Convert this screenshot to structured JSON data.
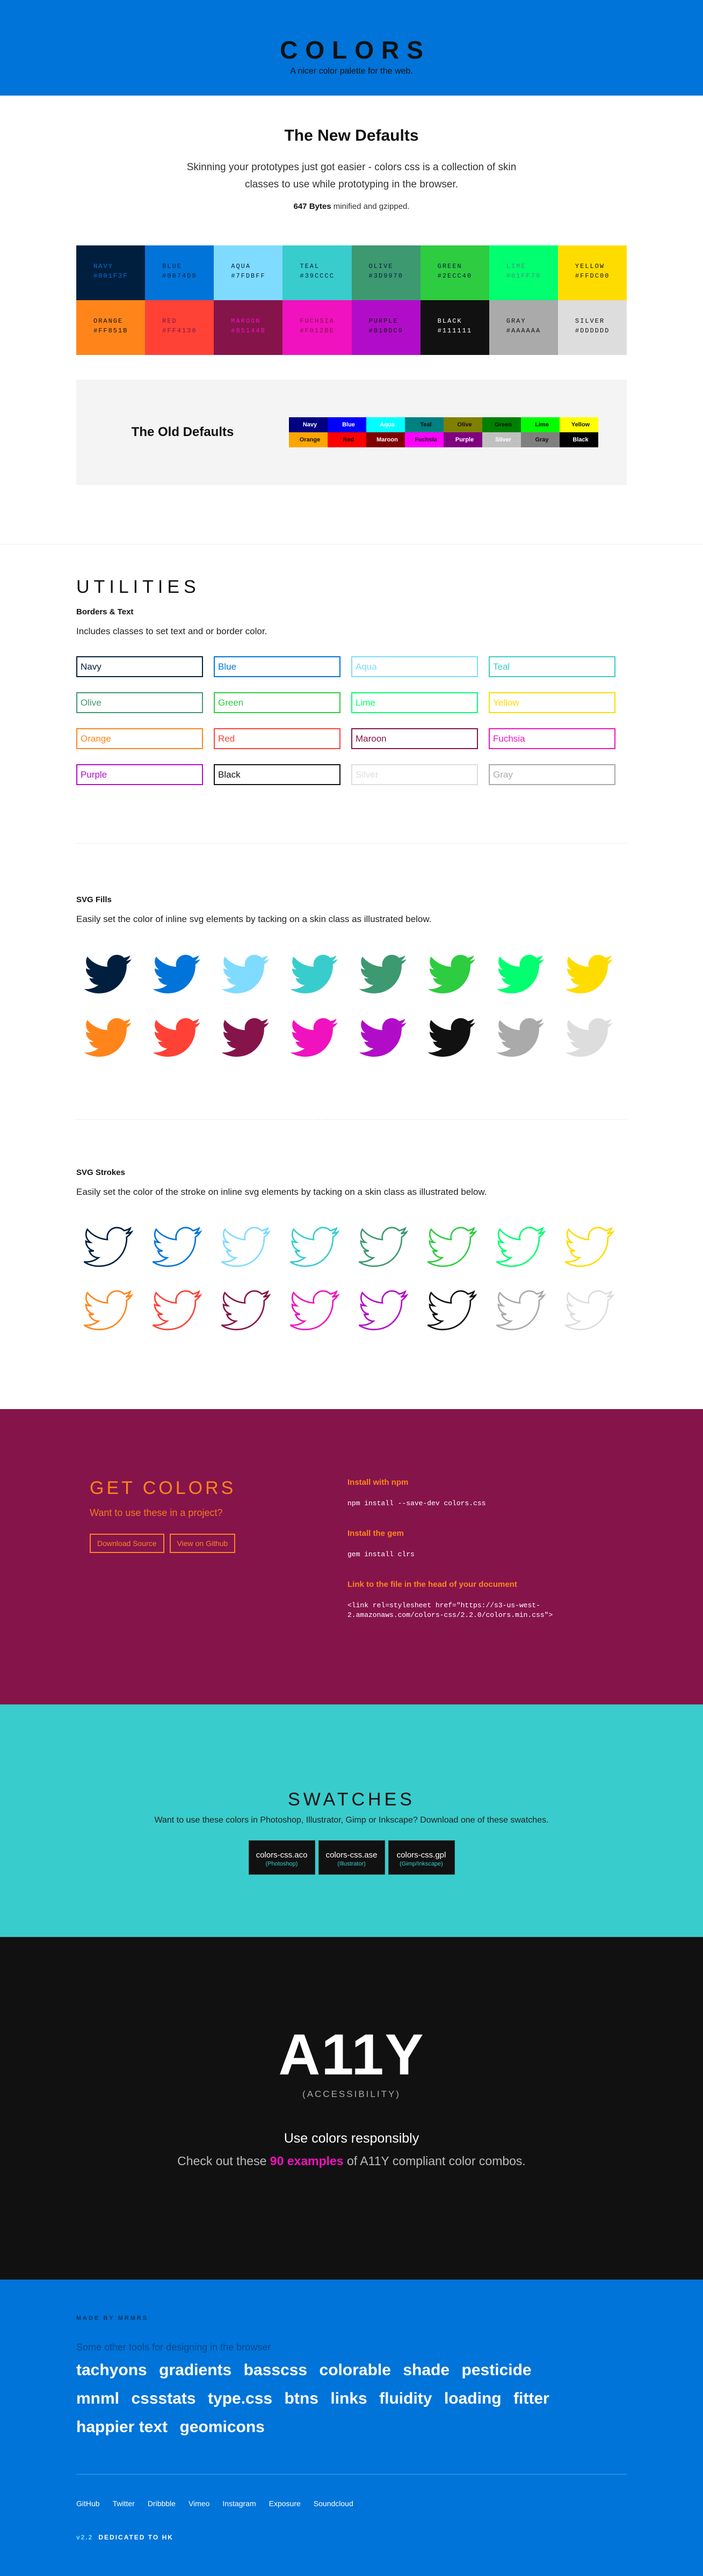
{
  "header": {
    "title": "COLORS",
    "tagline": "A nicer color palette for the web."
  },
  "defaults": {
    "title": "The New Defaults",
    "lead": "Skinning your prototypes just got easier - colors css is a collection of skin classes to use while prototyping in the browser.",
    "size_bold": "647 Bytes",
    "size_rest": " minified and gzipped.",
    "palette": [
      {
        "name": "NAVY",
        "hex": "#001F3F",
        "bg": "#001f3f",
        "fg": "#0074d9"
      },
      {
        "name": "BLUE",
        "hex": "#0074D9",
        "bg": "#0074d9",
        "fg": "#001f3f"
      },
      {
        "name": "AQUA",
        "hex": "#7FDBFF",
        "bg": "#7fdbff",
        "fg": "#001f3f"
      },
      {
        "name": "TEAL",
        "hex": "#39CCCC",
        "bg": "#39cccc",
        "fg": "#001f3f"
      },
      {
        "name": "OLIVE",
        "hex": "#3D9970",
        "bg": "#3d9970",
        "fg": "#001f3f"
      },
      {
        "name": "GREEN",
        "hex": "#2ECC40",
        "bg": "#2ecc40",
        "fg": "#001f3f"
      },
      {
        "name": "LIME",
        "hex": "#01FF70",
        "bg": "#01ff70",
        "fg": "#3d9970"
      },
      {
        "name": "YELLOW",
        "hex": "#FFDC00",
        "bg": "#ffdc00",
        "fg": "#111111"
      },
      {
        "name": "ORANGE",
        "hex": "#FF851B",
        "bg": "#ff851b",
        "fg": "#111111"
      },
      {
        "name": "RED",
        "hex": "#FF4136",
        "bg": "#ff4136",
        "fg": "#85144b"
      },
      {
        "name": "MAROON",
        "hex": "#85144B",
        "bg": "#85144b",
        "fg": "#f012be"
      },
      {
        "name": "FUCHSIA",
        "hex": "#F012BE",
        "bg": "#f012be",
        "fg": "#85144b"
      },
      {
        "name": "PURPLE",
        "hex": "#B10DC9",
        "bg": "#b10dc9",
        "fg": "#111111"
      },
      {
        "name": "BLACK",
        "hex": "#111111",
        "bg": "#111111",
        "fg": "#ffffff"
      },
      {
        "name": "GRAY",
        "hex": "#AAAAAA",
        "bg": "#aaaaaa",
        "fg": "#111111"
      },
      {
        "name": "SILVER",
        "hex": "#DDDDDD",
        "bg": "#dddddd",
        "fg": "#111111"
      }
    ],
    "old_title": "The Old Defaults",
    "old": [
      {
        "n": "Navy",
        "bg": "#000080",
        "fg": "#ffffff"
      },
      {
        "n": "Blue",
        "bg": "#0000ff",
        "fg": "#ffffff"
      },
      {
        "n": "Aqua",
        "bg": "#00ffff",
        "fg": "#ffffff"
      },
      {
        "n": "Teal",
        "bg": "#008080",
        "fg": "#111111"
      },
      {
        "n": "Olive",
        "bg": "#808000",
        "fg": "#111111"
      },
      {
        "n": "Green",
        "bg": "#008000",
        "fg": "#111111"
      },
      {
        "n": "Lime",
        "bg": "#00ff00",
        "fg": "#111111"
      },
      {
        "n": "Yellow",
        "bg": "#ffff00",
        "fg": "#111111"
      },
      {
        "n": "Orange",
        "bg": "#ffa500",
        "fg": "#111111"
      },
      {
        "n": "Red",
        "bg": "#ff0000",
        "fg": "#111111"
      },
      {
        "n": "Maroon",
        "bg": "#800000",
        "fg": "#ffffff"
      },
      {
        "n": "Fuchsia",
        "bg": "#ff00ff",
        "fg": "#111111"
      },
      {
        "n": "Purple",
        "bg": "#800080",
        "fg": "#ffffff"
      },
      {
        "n": "Silver",
        "bg": "#c0c0c0",
        "fg": "#ffffff"
      },
      {
        "n": "Gray",
        "bg": "#808080",
        "fg": "#111111"
      },
      {
        "n": "Black",
        "bg": "#000000",
        "fg": "#ffffff"
      }
    ]
  },
  "utilities": {
    "title": "UTILITIES",
    "sub": "Borders & Text",
    "desc": "Includes classes to set text and or border color.",
    "boxes": [
      {
        "n": "Navy",
        "c": "#001f3f"
      },
      {
        "n": "Blue",
        "c": "#0074d9"
      },
      {
        "n": "Aqua",
        "c": "#7fdbff"
      },
      {
        "n": "Teal",
        "c": "#39cccc"
      },
      {
        "n": "Olive",
        "c": "#3d9970"
      },
      {
        "n": "Green",
        "c": "#2ecc40"
      },
      {
        "n": "Lime",
        "c": "#01ff70"
      },
      {
        "n": "Yellow",
        "c": "#ffdc00"
      },
      {
        "n": "Orange",
        "c": "#ff851b"
      },
      {
        "n": "Red",
        "c": "#ff4136"
      },
      {
        "n": "Maroon",
        "c": "#85144b"
      },
      {
        "n": "Fuchsia",
        "c": "#f012be"
      },
      {
        "n": "Purple",
        "c": "#b10dc9"
      },
      {
        "n": "Black",
        "c": "#111111"
      },
      {
        "n": "Silver",
        "c": "#dddddd"
      },
      {
        "n": "Gray",
        "c": "#aaaaaa"
      }
    ]
  },
  "fills": {
    "title": "SVG Fills",
    "desc": "Easily set the color of inline svg elements by tacking on a skin class as illustrated below.",
    "colors": [
      "#001f3f",
      "#0074d9",
      "#7fdbff",
      "#39cccc",
      "#3d9970",
      "#2ecc40",
      "#01ff70",
      "#ffdc00",
      "#ff851b",
      "#ff4136",
      "#85144b",
      "#f012be",
      "#b10dc9",
      "#111111",
      "#aaaaaa",
      "#dddddd"
    ],
    "icon": "twitter-bird-icon"
  },
  "strokes": {
    "title": "SVG Strokes",
    "desc": "Easily set the color of the stroke on inline svg elements by tacking on a skin class as illustrated below."
  },
  "get": {
    "title": "GET COLORS",
    "ask": "Want to use these in a project?",
    "btn_download": "Download Source",
    "btn_github": "View on Github",
    "npm_h": "Install with npm",
    "npm_code": "npm install --save-dev colors.css",
    "gem_h": "Install the gem",
    "gem_code": "gem install clrs",
    "link_h": "Link to the file in the head of your document",
    "link_code": "<link rel=stylesheet href=\"https://s3-us-west-2.amazonaws.com/colors-css/2.2.0/colors.min.css\">"
  },
  "swatches": {
    "title": "SWATCHES",
    "desc": "Want to use these colors in Photoshop, Illustrator, Gimp or Inkscape? Download one of these swatches.",
    "files": [
      {
        "f": "colors-css.aco",
        "t": "(Photoshop)"
      },
      {
        "f": "colors-css.ase",
        "t": "(Illustrator)"
      },
      {
        "f": "colors-css.gpl",
        "t": "(Gimp/Inkscape)"
      }
    ]
  },
  "a11y": {
    "title": "A11Y",
    "sub": "(ACCESSIBILITY)",
    "use": "Use colors responsibly",
    "pre": "Check out these ",
    "link": "90 examples",
    "post": " of A11Y compliant color combos."
  },
  "footer": {
    "made": "MADE BY MRMRS",
    "tools_h": "Some other tools for designing in the browser",
    "tools": [
      "tachyons",
      "gradients",
      "basscss",
      "colorable",
      "shade",
      "pesticide",
      "mnml",
      "cssstats",
      "type.css",
      "btns",
      "links",
      "fluidity",
      "loading",
      "fitter happier text",
      "geomicons"
    ],
    "links": [
      "GitHub",
      "Twitter",
      "Dribbble",
      "Vimeo",
      "Instagram",
      "Exposure",
      "Soundcloud"
    ],
    "version": "v2.2",
    "dedication": "DEDICATED TO HK"
  }
}
